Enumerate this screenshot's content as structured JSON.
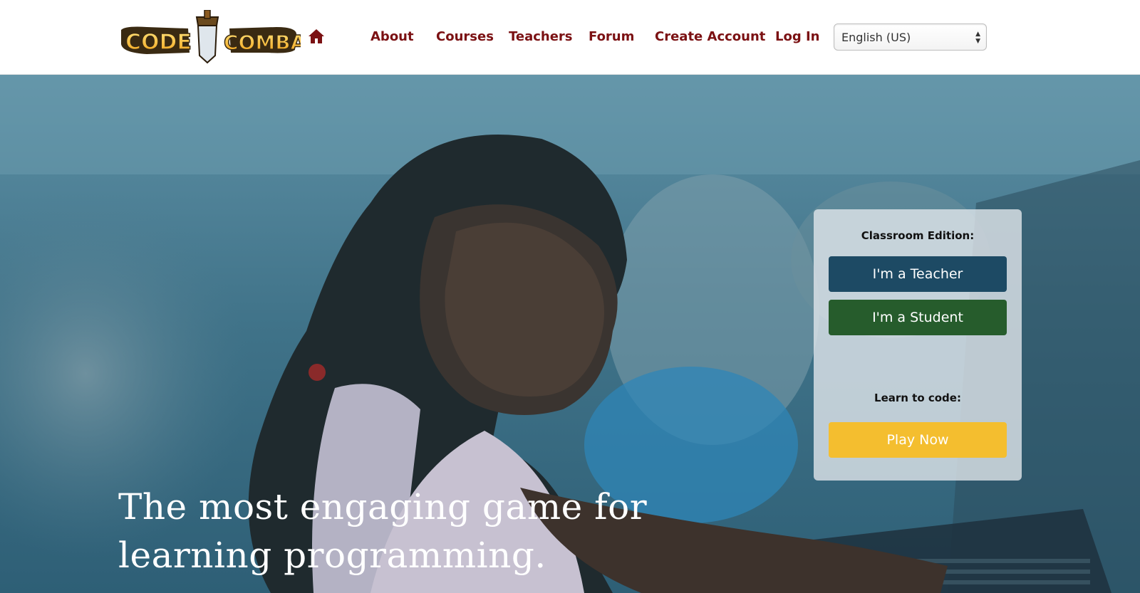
{
  "brand": {
    "logo_text_left": "CODE",
    "logo_text_right": "COMBAT"
  },
  "nav": {
    "items": [
      {
        "label": "About"
      },
      {
        "label": "Courses"
      },
      {
        "label": "Teachers"
      },
      {
        "label": "Forum"
      },
      {
        "label": "Create Account"
      },
      {
        "label": "Log In"
      }
    ]
  },
  "language": {
    "selected": "English (US)"
  },
  "hero": {
    "headline": "The most engaging game for learning programming."
  },
  "panel": {
    "classroom_label": "Classroom Edition:",
    "teacher_button": "I'm a Teacher",
    "student_button": "I'm a Student",
    "learn_label": "Learn to code:",
    "play_button": "Play Now"
  },
  "colors": {
    "nav_text": "#7b1113",
    "teacher_btn": "#1d4a64",
    "student_btn": "#265c2c",
    "play_btn": "#f4be2f",
    "hero_tint": "#3a6e86"
  },
  "icons": {
    "home": "home-icon",
    "select_arrows": "select-arrows-icon"
  }
}
